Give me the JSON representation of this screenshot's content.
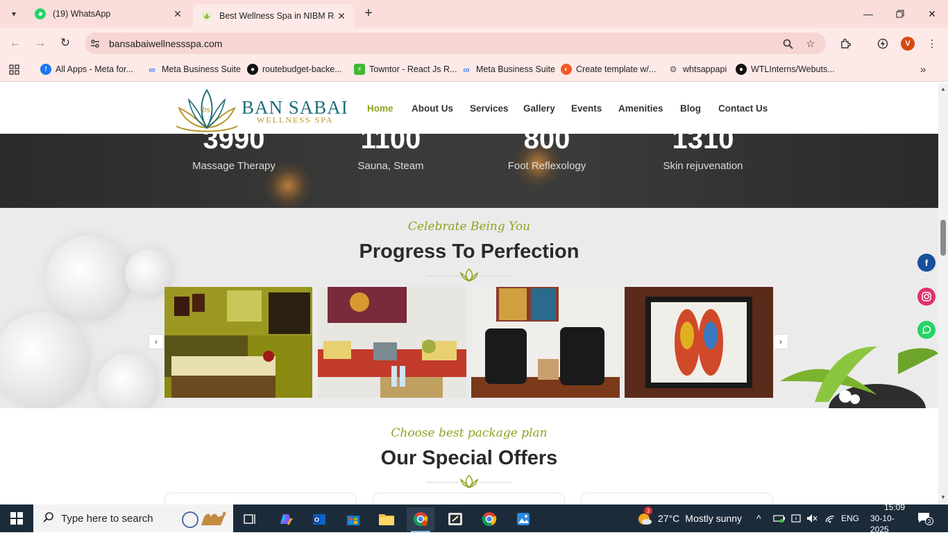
{
  "browser": {
    "tabs": [
      {
        "title": "(19) WhatsApp",
        "active": false
      },
      {
        "title": "Best Wellness Spa in NIBM Roa",
        "active": true
      }
    ],
    "url": "bansabaiwellnessspa.com",
    "profile_initial": "V",
    "bookmarks": [
      {
        "label": "All Apps - Meta for...",
        "icon": "facebook-icon"
      },
      {
        "label": "Meta Business Suite",
        "icon": "meta-icon"
      },
      {
        "label": "routebudget-backe...",
        "icon": "github-icon"
      },
      {
        "label": "Towntor - React Js R...",
        "icon": "towntor-icon"
      },
      {
        "label": "Meta Business Suite",
        "icon": "meta-icon"
      },
      {
        "label": "Create template w/...",
        "icon": "template-icon"
      },
      {
        "label": "whtsappapi",
        "icon": "api-icon"
      },
      {
        "label": "WTLInterns/Webuts...",
        "icon": "github-icon"
      }
    ]
  },
  "site": {
    "logo": {
      "line1": "BAN SABAI",
      "line2": "WELLNESS SPA",
      "mark": "bs"
    },
    "nav": [
      {
        "label": "Home",
        "active": true
      },
      {
        "label": "About Us",
        "active": false
      },
      {
        "label": "Services",
        "active": false
      },
      {
        "label": "Gallery",
        "active": false
      },
      {
        "label": "Events",
        "active": false
      },
      {
        "label": "Amenities",
        "active": false
      },
      {
        "label": "Blog",
        "active": false
      },
      {
        "label": "Contact Us",
        "active": false
      }
    ],
    "stats": [
      {
        "number": "3990",
        "label": "Massage Therapy"
      },
      {
        "number": "1100",
        "label": "Sauna, Steam"
      },
      {
        "number": "800",
        "label": "Foot Reflexology"
      },
      {
        "number": "1310",
        "label": "Skin rejuvenation"
      }
    ],
    "gallery": {
      "script_heading": "Celebrate Being You",
      "heading": "Progress To Perfection",
      "prev": "‹",
      "next": "›"
    },
    "offers": {
      "script_heading": "Choose best package plan",
      "heading": "Our Special Offers"
    },
    "social": [
      "facebook-icon",
      "instagram-icon",
      "whatsapp-icon"
    ]
  },
  "taskbar": {
    "search_placeholder": "Type here to search",
    "weather": {
      "temp": "27°C",
      "condition": "Mostly sunny",
      "badge": "3"
    },
    "language": "ENG",
    "time": "15:09",
    "date": "30-10-2025",
    "notifications": "3"
  },
  "colors": {
    "accent_green": "#8aa51f",
    "logo_teal": "#1f6f79",
    "logo_gold": "#b8962c",
    "tab_bar": "#fbdedb"
  }
}
